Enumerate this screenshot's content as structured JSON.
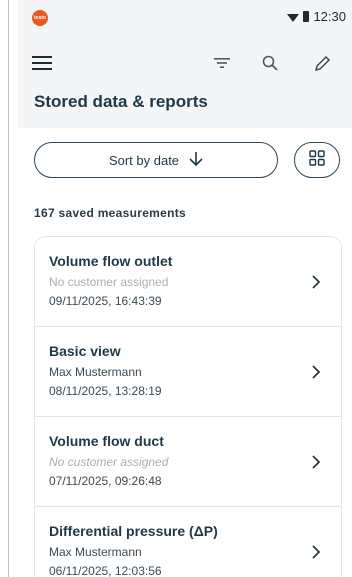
{
  "status_bar": {
    "time": "12:30",
    "brand": "testo"
  },
  "header": {
    "title": "Stored data & reports"
  },
  "sort": {
    "label": "Sort by date"
  },
  "summary": {
    "count_label": "167 saved measurements"
  },
  "measurements": [
    {
      "title": "Volume flow outlet",
      "customer": "No customer assigned",
      "date": "09/11/2025, 16:43:39"
    },
    {
      "title": "Basic view",
      "customer": "Max Mustermann",
      "date": "08/11/2025, 13:28:19"
    },
    {
      "title": "Volume flow duct",
      "customer": "No customer assigned",
      "date": "07/11/2025, 09:26:48"
    },
    {
      "title": "Differential pressure (ΔP)",
      "customer": "Max Mustermann",
      "date": "06/11/2025, 12:03:56"
    }
  ],
  "icons": [
    "menu-icon",
    "filter-icon",
    "search-icon",
    "edit-icon",
    "arrow-down-icon",
    "grid-view-icon",
    "chevron-right-icon",
    "wifi-icon",
    "battery-icon"
  ],
  "colors": {
    "accent": "#e85a21",
    "primary_text": "#1f3848",
    "header_bg": "#f3f5f7"
  }
}
